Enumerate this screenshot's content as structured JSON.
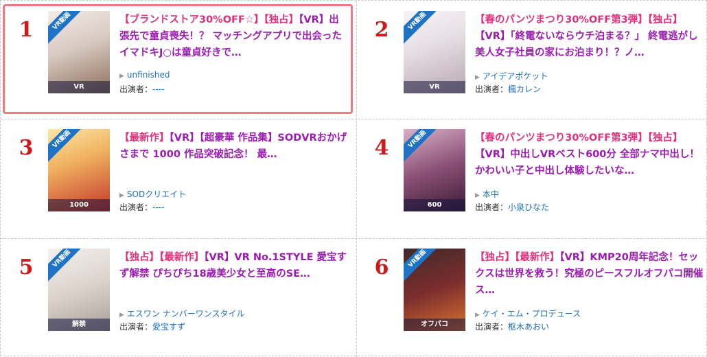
{
  "badge": "VR動画",
  "items": [
    {
      "rank": "1",
      "thumb_caption": "VR",
      "tags": [
        {
          "text": "【ブランドストア30%OFF☆】",
          "style": "sale"
        },
        {
          "text": "【独占】",
          "style": "sale"
        }
      ],
      "title_rest": "【VR】出張先で童貞喪失！？ マッチングアプリで出会ったイマドキJ○は童貞好きで…",
      "maker": "unfinished",
      "cast_label": "出演者：",
      "cast": "----",
      "highlighted": true
    },
    {
      "rank": "2",
      "thumb_caption": "VR",
      "tags": [
        {
          "text": "【春のパンツまつり30%OFF第3弾】",
          "style": "sale"
        },
        {
          "text": "【独占】",
          "style": "sale"
        }
      ],
      "title_rest": "【VR】「終電ないならウチ泊まる？」 終電逃がし美人女子社員の家にお泊まり！？ノ…",
      "maker": "アイデアポケット",
      "cast_label": "出演者：",
      "cast": "楓カレン",
      "highlighted": false
    },
    {
      "rank": "3",
      "thumb_caption": "1000",
      "tags": [
        {
          "text": "【最新作】",
          "style": "sale"
        }
      ],
      "title_rest": "【VR】【超豪華 作品集】SODVRおかげさまで 1000 作品突破記念！ 最…",
      "maker": "SODクリエイト",
      "cast_label": "出演者：",
      "cast": "----",
      "highlighted": false
    },
    {
      "rank": "4",
      "thumb_caption": "600",
      "tags": [
        {
          "text": "【春のパンツまつり30%OFF第3弾】",
          "style": "sale"
        },
        {
          "text": "【独占】",
          "style": "sale"
        }
      ],
      "title_rest": "【VR】中出しVRベスト600分 全部ナマ中出し！かわいい子と中出し体験したいな…",
      "maker": "本中",
      "cast_label": "出演者：",
      "cast": "小泉ひなた",
      "highlighted": false
    },
    {
      "rank": "5",
      "thumb_caption": "解禁",
      "tags": [
        {
          "text": "【独占】",
          "style": "sale"
        },
        {
          "text": "【最新作】",
          "style": "sale"
        }
      ],
      "title_rest": "【VR】VR No.1STYLE 愛宝すず解禁 ぴちぴち18歳美少女と至高のSE…",
      "maker": "エスワン ナンバーワンスタイル",
      "cast_label": "出演者：",
      "cast": "愛宝すず",
      "highlighted": false
    },
    {
      "rank": "6",
      "thumb_caption": "オフパコ",
      "tags": [
        {
          "text": "【独占】",
          "style": "sale"
        },
        {
          "text": "【最新作】",
          "style": "sale"
        }
      ],
      "title_rest": "【VR】KMP20周年記念！セックスは世界を救う！究極のピースフルオフパコ開催ス…",
      "maker": "ケイ・エム・プロデュース",
      "cast_label": "出演者：",
      "cast": "枢木あおい",
      "highlighted": false
    }
  ]
}
